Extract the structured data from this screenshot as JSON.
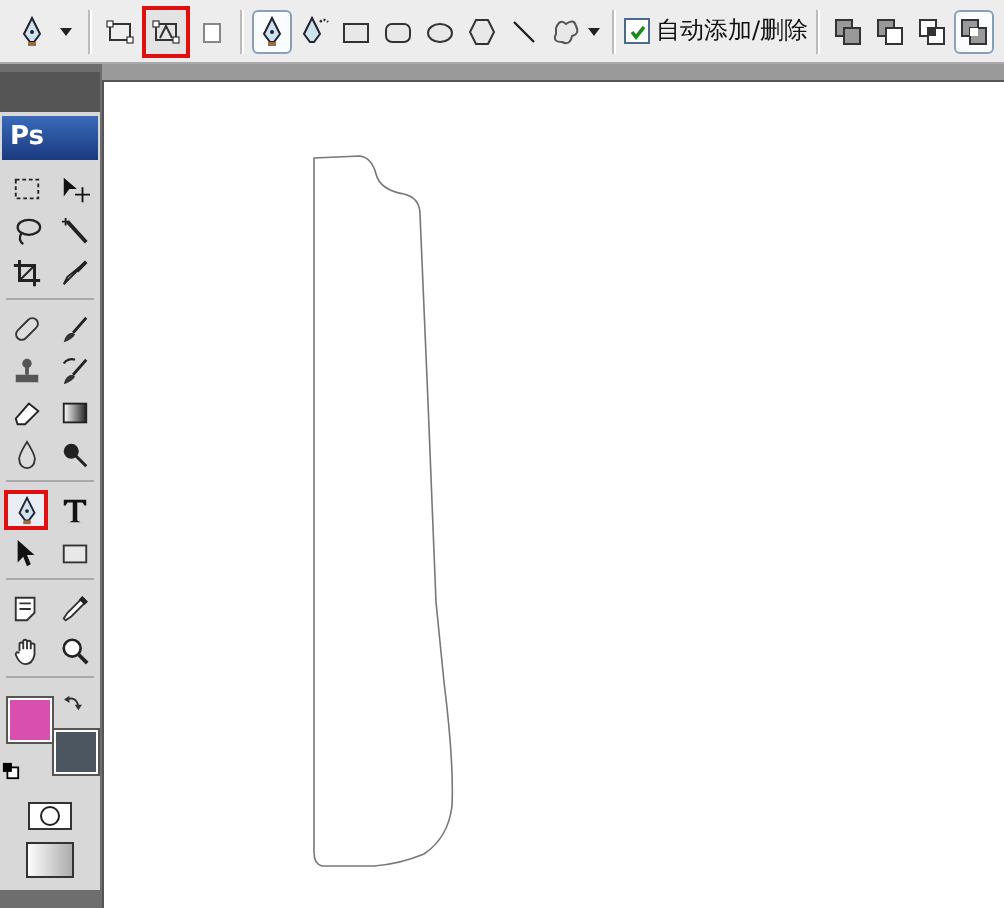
{
  "options_bar": {
    "tool_preset": {
      "kind": "pen"
    },
    "mode_buttons": [
      {
        "kind": "shape-layers",
        "selected": false
      },
      {
        "kind": "paths",
        "selected": true
      },
      {
        "kind": "fill-pixels",
        "selected": false
      }
    ],
    "draw_tools": [
      {
        "kind": "pen",
        "selected": true
      },
      {
        "kind": "freeform-pen",
        "selected": false
      },
      {
        "kind": "rectangle",
        "selected": false
      },
      {
        "kind": "rounded-rectangle",
        "selected": false
      },
      {
        "kind": "ellipse",
        "selected": false
      },
      {
        "kind": "polygon",
        "selected": false
      },
      {
        "kind": "line",
        "selected": false
      },
      {
        "kind": "custom-shape",
        "selected": false
      }
    ],
    "auto_add_delete": {
      "label": "自动添加/删除",
      "checked": true
    },
    "combine_modes": [
      {
        "kind": "add",
        "selected": false
      },
      {
        "kind": "subtract",
        "selected": false
      },
      {
        "kind": "intersect",
        "selected": false
      },
      {
        "kind": "exclude",
        "selected": true
      }
    ]
  },
  "toolbox": {
    "logo": "Ps",
    "groups": [
      [
        {
          "kind": "marquee",
          "selected": false
        },
        {
          "kind": "move",
          "selected": false
        },
        {
          "kind": "lasso",
          "selected": false
        },
        {
          "kind": "magic-wand",
          "selected": false
        },
        {
          "kind": "crop",
          "selected": false
        },
        {
          "kind": "slice",
          "selected": false
        }
      ],
      [
        {
          "kind": "healing",
          "selected": false
        },
        {
          "kind": "brush",
          "selected": false
        },
        {
          "kind": "stamp",
          "selected": false
        },
        {
          "kind": "history-brush",
          "selected": false
        },
        {
          "kind": "eraser",
          "selected": false
        },
        {
          "kind": "gradient",
          "selected": false
        },
        {
          "kind": "blur",
          "selected": false
        },
        {
          "kind": "dodge",
          "selected": false
        }
      ],
      [
        {
          "kind": "pen",
          "selected": true
        },
        {
          "kind": "type",
          "selected": false
        },
        {
          "kind": "path-selection",
          "selected": false
        },
        {
          "kind": "rectangle",
          "selected": false
        }
      ],
      [
        {
          "kind": "notes",
          "selected": false
        },
        {
          "kind": "eyedropper",
          "selected": false
        },
        {
          "kind": "hand",
          "selected": false
        },
        {
          "kind": "zoom",
          "selected": false
        }
      ]
    ],
    "foreground": {
      "color": "#d94fb0"
    },
    "background": {
      "color": "#4b5660"
    }
  }
}
